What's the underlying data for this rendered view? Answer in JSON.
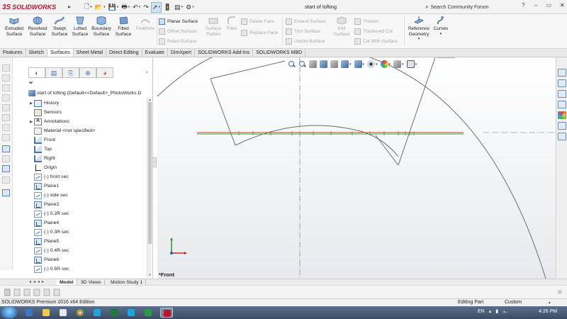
{
  "app": {
    "logo_text": "SOLIDWORKS",
    "logo_mark": "3S",
    "document_title": "start of lofting",
    "search_placeholder": "Search Community Forum"
  },
  "command_manager": {
    "large_buttons": [
      {
        "label": "Extruded Surface",
        "enabled": true
      },
      {
        "label": "Revolved Surface",
        "enabled": true
      },
      {
        "label": "Swept Surface",
        "enabled": true
      },
      {
        "label": "Lofted Surface",
        "enabled": true
      },
      {
        "label": "Boundary Surface",
        "enabled": true
      },
      {
        "label": "Filled Surface",
        "enabled": true
      },
      {
        "label": "Freeform",
        "enabled": false
      }
    ],
    "group1": [
      {
        "label": "Planar Surface",
        "enabled": true
      },
      {
        "label": "Offset Surface",
        "enabled": false
      },
      {
        "label": "Ruled Surface",
        "enabled": false
      }
    ],
    "surface_flatten": "Surface Flatten",
    "fillet": "Fillet",
    "group2": [
      {
        "label": "Delete Face",
        "enabled": false
      },
      {
        "label": "Replace Face",
        "enabled": false
      }
    ],
    "group3": [
      {
        "label": "Extend Surface",
        "enabled": false
      },
      {
        "label": "Trim Surface",
        "enabled": false
      },
      {
        "label": "Untrim Surface",
        "enabled": false
      }
    ],
    "knit_surface": "Knit Surface",
    "group4": [
      {
        "label": "Thicken",
        "enabled": false
      },
      {
        "label": "Thickened Cut",
        "enabled": false
      },
      {
        "label": "Cut With Surface",
        "enabled": false
      }
    ],
    "reference_geometry": "Reference Geometry",
    "curves": "Curves"
  },
  "tabs": [
    "Features",
    "Sketch",
    "Surfaces",
    "Sheet Metal",
    "Direct Editing",
    "Evaluate",
    "DimXpert",
    "SOLIDWORKS Add-Ins",
    "SOLIDWORKS MBD"
  ],
  "active_tab": "Surfaces",
  "feature_manager": {
    "root": "start of lofting  (Default<<Default>_PhotoWorks D",
    "items": [
      {
        "label": "History",
        "icon": "folder",
        "expand": true
      },
      {
        "label": "Sensors",
        "icon": "sensor",
        "expand": false
      },
      {
        "label": "Annotations",
        "icon": "annot",
        "expand": true
      },
      {
        "label": "Material <not specified>",
        "icon": "mat",
        "expand": false
      },
      {
        "label": "Front",
        "icon": "plane",
        "expand": false
      },
      {
        "label": "Top",
        "icon": "plane",
        "expand": false
      },
      {
        "label": "Right",
        "icon": "plane",
        "expand": false
      },
      {
        "label": "Origin",
        "icon": "origin",
        "expand": false
      },
      {
        "label": "(-) front sec",
        "icon": "sketch",
        "expand": false
      },
      {
        "label": "Plane1",
        "icon": "sketch-plane",
        "expand": false
      },
      {
        "label": "(-) side sec",
        "icon": "sketch",
        "expand": false
      },
      {
        "label": "Plane3",
        "icon": "sketch-plane",
        "expand": false
      },
      {
        "label": "(-) 0.2R sec",
        "icon": "sketch",
        "expand": false
      },
      {
        "label": "Plane4",
        "icon": "sketch-plane",
        "expand": false
      },
      {
        "label": "(-) 0.3R sec",
        "icon": "sketch",
        "expand": false
      },
      {
        "label": "Plane5",
        "icon": "sketch-plane",
        "expand": false
      },
      {
        "label": "(-) 0.4R sec",
        "icon": "sketch",
        "expand": false
      },
      {
        "label": "Plane6",
        "icon": "sketch-plane",
        "expand": false
      },
      {
        "label": "(-) 0.5R sec",
        "icon": "sketch",
        "expand": false
      }
    ]
  },
  "bottom_tabs": [
    "Model",
    "3D Views",
    "Motion Study 1"
  ],
  "active_bottom_tab": "Model",
  "graphics": {
    "view_label": "*Front"
  },
  "status": {
    "edition": "SOLIDWORKS Premium 2016 x64 Edition",
    "mode": "Editing Part",
    "units": "Custom"
  },
  "taskbar": {
    "language": "EN",
    "time": "4:26 PM"
  },
  "colors": {
    "accent": "#c8102e",
    "sketch_line": "#6d6d6d",
    "plane_green": "#3aa63a",
    "plane_red": "#d23a2a"
  }
}
